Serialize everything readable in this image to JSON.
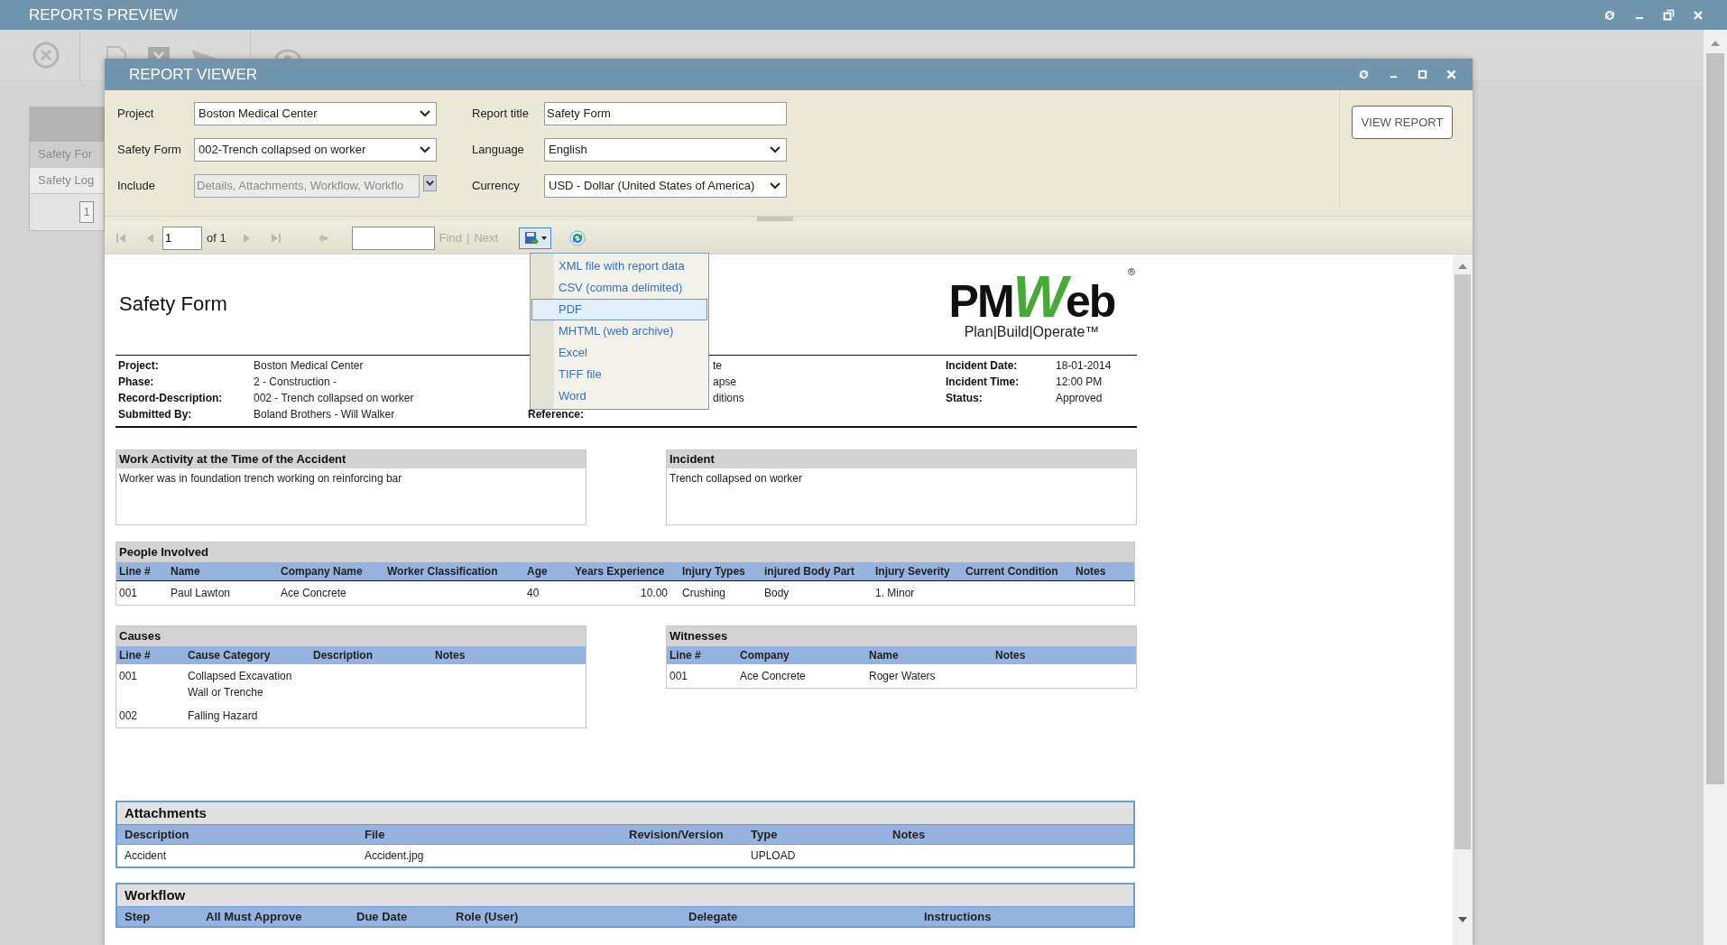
{
  "app": {
    "title": "REPORTS PREVIEW"
  },
  "background_list": {
    "items": [
      {
        "label": "Safety For",
        "selected": true
      },
      {
        "label": "Safety Log",
        "selected": false
      }
    ],
    "page": "1"
  },
  "viewer": {
    "title": "REPORT VIEWER",
    "parameters": [
      {
        "label": "Project",
        "kind": "select",
        "value": "Boston Medical Center",
        "disabled": false
      },
      {
        "label": "Report title",
        "kind": "text",
        "value": "Safety Form",
        "disabled": false
      },
      {
        "label": "Safety Form",
        "kind": "select",
        "value": "002-Trench collapsed on worker",
        "disabled": false
      },
      {
        "label": "Language",
        "kind": "select",
        "value": "English",
        "disabled": false
      },
      {
        "label": "Include",
        "kind": "multiselect",
        "value": "Details, Attachments, Workflow, Workflo",
        "disabled": true
      },
      {
        "label": "Currency",
        "kind": "select",
        "value": "USD - Dollar (United States of America)",
        "disabled": false
      }
    ],
    "view_button": "VIEW REPORT",
    "toolbar": {
      "page": "1",
      "of": "of 1",
      "find": "Find",
      "separator": "|",
      "next": "Next",
      "export_pressed": true
    },
    "export_menu": [
      {
        "label": "XML file with report data",
        "selected": false
      },
      {
        "label": "CSV (comma delimited)",
        "selected": false
      },
      {
        "label": "PDF",
        "selected": true
      },
      {
        "label": "MHTML (web archive)",
        "selected": false
      },
      {
        "label": "Excel",
        "selected": false
      },
      {
        "label": "TIFF file",
        "selected": false
      },
      {
        "label": "Word",
        "selected": false
      }
    ]
  },
  "report": {
    "title": "Safety Form",
    "logo": {
      "name": "PMWeb",
      "tagline": "Plan|Build|Operate™",
      "mark": "®"
    },
    "details": {
      "left": [
        {
          "label": "Project:",
          "value": "Boston Medical Center"
        },
        {
          "label": "Phase:",
          "value": "2 - Construction -"
        },
        {
          "label": "Record-Description:",
          "value": "002 - Trench collapsed on worker"
        },
        {
          "label": "Submitted By:",
          "value": "Boland Brothers - Will Walker"
        }
      ],
      "middle": [
        {
          "value": "te"
        },
        {
          "value": "apse"
        },
        {
          "value": "ditions"
        },
        {
          "label": "Reference:"
        }
      ],
      "right": [
        {
          "label": "Incident Date:",
          "value": "18-01-2014"
        },
        {
          "label": "Incident Time:",
          "value": "12:00 PM"
        },
        {
          "label": "Status:",
          "value": "Approved"
        }
      ]
    },
    "rows": [
      {
        "sections": [
          {
            "kind": "text",
            "title": "Work Activity at the Time of the Accident",
            "text": "Worker was in foundation trench working on reinforcing bar"
          },
          {
            "kind": "text",
            "title": "Incident",
            "text": "Trench collapsed on worker"
          }
        ]
      },
      {
        "sections": [
          {
            "kind": "table",
            "title": "People Involved",
            "columns": [
              "Line #",
              "Name",
              "Company Name",
              "Worker Classification",
              "Age",
              "Years Experience",
              "Injury Types",
              "injured Body Part",
              "Injury Severity",
              "Current Condition",
              "Notes"
            ],
            "rows": [
              [
                "001",
                "Paul Lawton",
                "Ace Concrete",
                "",
                "40",
                "10.00",
                "Crushing",
                "Body",
                "1. Minor",
                "",
                ""
              ]
            ]
          }
        ]
      },
      {
        "sections": [
          {
            "kind": "table",
            "title": "Causes",
            "columns": [
              "Line #",
              "Cause Category",
              "Description",
              "Notes"
            ],
            "rows": [
              [
                "001",
                "Collapsed Excavation Wall or Trenche",
                "",
                ""
              ],
              [
                "002",
                "Falling Hazard",
                "",
                ""
              ]
            ]
          },
          {
            "kind": "table",
            "title": "Witnesses",
            "columns": [
              "Line #",
              "Company",
              "Name",
              "Notes"
            ],
            "rows": [
              [
                "001",
                "Ace Concrete",
                "Roger Waters",
                ""
              ]
            ]
          }
        ]
      },
      {
        "sections": [
          {
            "kind": "framed_table",
            "title": "Attachments",
            "columns": [
              "Description",
              "File",
              "Revision/Version",
              "Type",
              "Notes"
            ],
            "rows": [
              [
                "Accident",
                "Accident.jpg",
                "",
                "UPLOAD",
                ""
              ]
            ]
          }
        ]
      },
      {
        "sections": [
          {
            "kind": "framed_table",
            "title": "Workflow",
            "columns": [
              "Step",
              "All Must Approve",
              "Due Date",
              "Role (User)",
              "Delegate",
              "Instructions"
            ]
          }
        ]
      }
    ]
  }
}
